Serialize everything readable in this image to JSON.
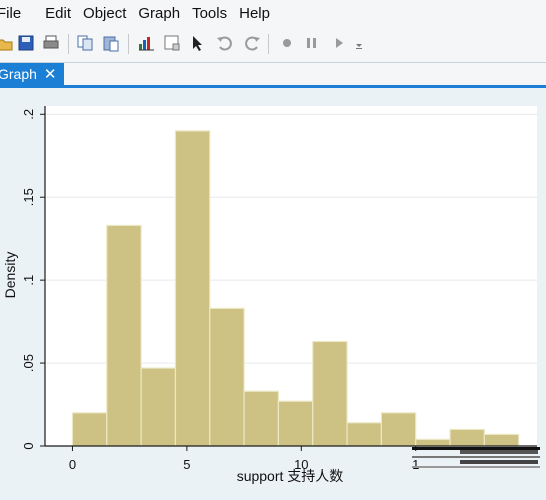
{
  "menubar": {
    "items": [
      "File",
      "Edit",
      "Object",
      "Graph",
      "Tools",
      "Help"
    ]
  },
  "toolbar": {
    "buttons": [
      "open-icon",
      "save-icon",
      "print-icon",
      "copy-icon",
      "paste-icon",
      "graph-editor-icon",
      "recorder-icon",
      "pointer-icon",
      "undo-icon",
      "redo-icon",
      "record-icon",
      "pause-icon",
      "play-icon",
      "dropdown-icon"
    ]
  },
  "tab": {
    "label": "Graph",
    "close": "✕"
  },
  "colors": {
    "bar_fill": "#cdc283",
    "bar_stroke": "#ece8c6",
    "accent": "#1b7fd6"
  },
  "chart_data": {
    "type": "bar",
    "title": "",
    "xlabel": "support 支持人数",
    "ylabel": "Density",
    "xlim": [
      -1.2,
      20.3
    ],
    "ylim": [
      0,
      0.205
    ],
    "xticks": [
      0,
      5,
      10,
      15
    ],
    "xtick_labels": [
      "0",
      "5",
      "10",
      "1"
    ],
    "yticks": [
      0,
      0.05,
      0.1,
      0.15,
      0.2
    ],
    "ytick_labels": [
      "0",
      ".05",
      ".1",
      ".15",
      ".2"
    ],
    "bin_edges": [
      0,
      1.5,
      3,
      4.5,
      6,
      7.5,
      9,
      10.5,
      12,
      13.5,
      15,
      16.5,
      18,
      19.5
    ],
    "values": [
      0.02,
      0.133,
      0.047,
      0.19,
      0.083,
      0.033,
      0.027,
      0.063,
      0.014,
      0.02,
      0.004,
      0.01,
      0.007
    ],
    "grid": true
  }
}
